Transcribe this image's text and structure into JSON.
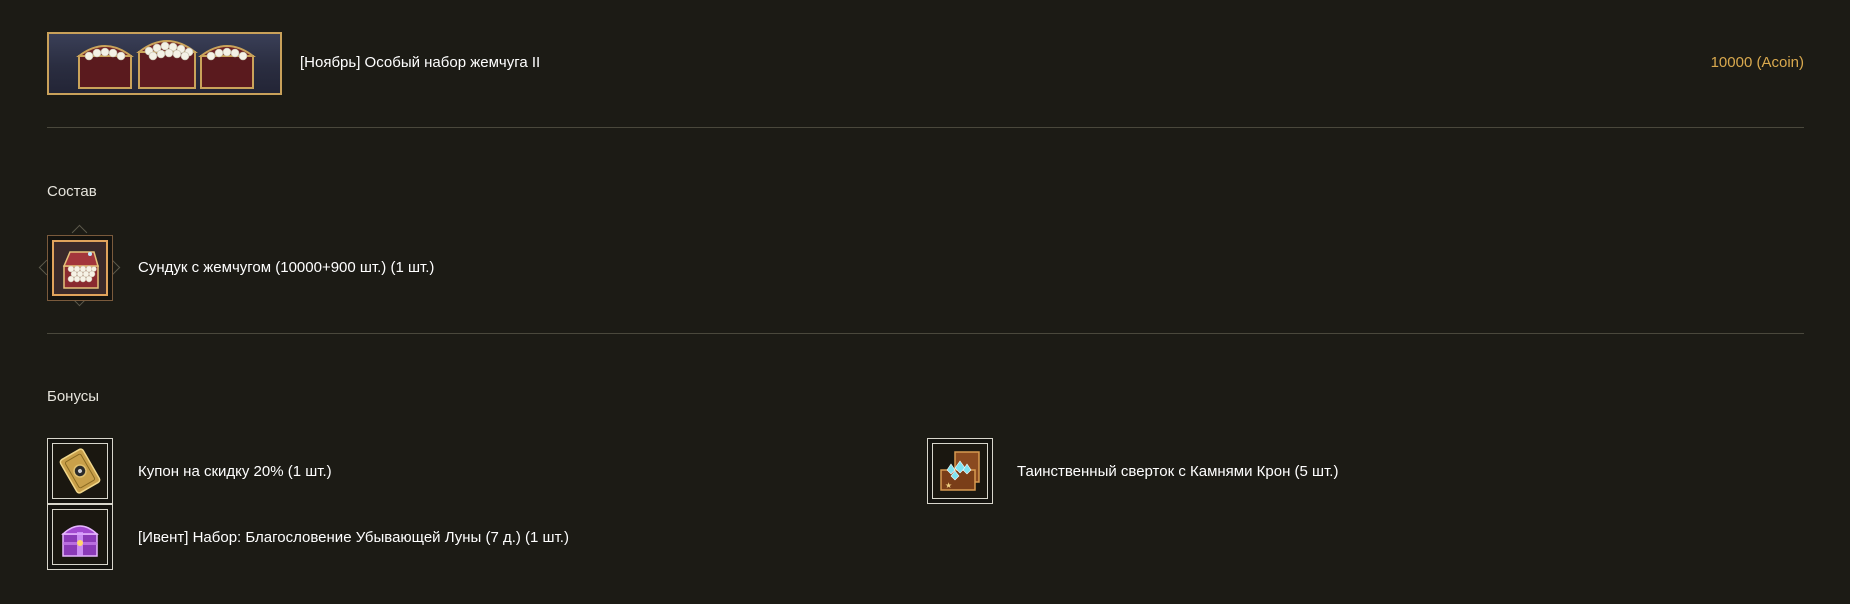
{
  "product": {
    "title": "[Ноябрь] Особый набор жемчуга II",
    "price": "10000 (Acoin)",
    "banner_icon": "pearl-chests-banner"
  },
  "sections": {
    "contents": {
      "title": "Состав",
      "items": [
        {
          "label": "Сундук с жемчугом (10000+900 шт.) (1 шт.)",
          "icon": "pearl-chest-icon"
        }
      ]
    },
    "bonuses": {
      "title": "Бонусы",
      "items": [
        {
          "label": "Купон на скидку 20% (1 шт.)",
          "icon": "coupon-icon"
        },
        {
          "label": "Таинственный сверток с Камнями Крон (5 шт.)",
          "icon": "mystery-crown-stones-icon"
        },
        {
          "label": "[Ивент] Набор: Благословение Убывающей Луны (7 д.) (1 шт.)",
          "icon": "purple-chest-icon"
        }
      ]
    }
  },
  "colors": {
    "background": "#1c1b15",
    "price": "#d9a94e",
    "banner_border": "#c9a15a",
    "divider": "#4a483c"
  }
}
